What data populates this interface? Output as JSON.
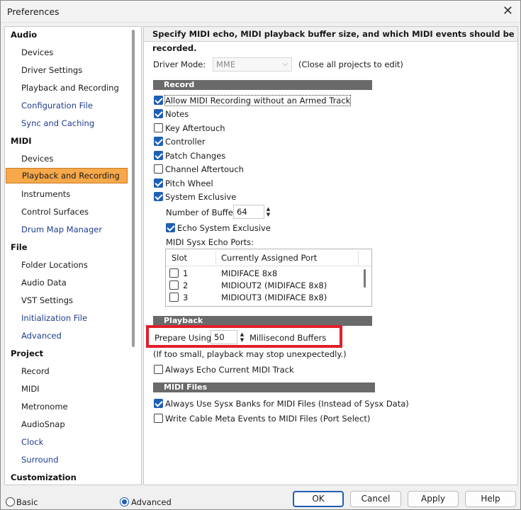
{
  "window": {
    "title": "Preferences"
  },
  "tree": {
    "sections": [
      {
        "label": "Audio",
        "items": [
          {
            "label": "Devices",
            "link": false
          },
          {
            "label": "Driver Settings",
            "link": false
          },
          {
            "label": "Playback and Recording",
            "link": false
          },
          {
            "label": "Configuration File",
            "link": true
          },
          {
            "label": "Sync and Caching",
            "link": true
          }
        ]
      },
      {
        "label": "MIDI",
        "items": [
          {
            "label": "Devices",
            "link": false
          },
          {
            "label": "Playback and Recording",
            "link": false,
            "selected": true
          },
          {
            "label": "Instruments",
            "link": false
          },
          {
            "label": "Control Surfaces",
            "link": false
          },
          {
            "label": "Drum Map Manager",
            "link": true
          }
        ]
      },
      {
        "label": "File",
        "items": [
          {
            "label": "Folder Locations",
            "link": false
          },
          {
            "label": "Audio Data",
            "link": false
          },
          {
            "label": "VST Settings",
            "link": false
          },
          {
            "label": "Initialization File",
            "link": true
          },
          {
            "label": "Advanced",
            "link": true
          }
        ]
      },
      {
        "label": "Project",
        "items": [
          {
            "label": "Record",
            "link": false
          },
          {
            "label": "MIDI",
            "link": false
          },
          {
            "label": "Metronome",
            "link": false
          },
          {
            "label": "AudioSnap",
            "link": false
          },
          {
            "label": "Clock",
            "link": true
          },
          {
            "label": "Surround",
            "link": true
          }
        ]
      },
      {
        "label": "Customization",
        "items": []
      }
    ]
  },
  "panel": {
    "description": "Specify MIDI echo, MIDI playback buffer size, and which MIDI events should be recorded.",
    "driver_mode": {
      "label": "Driver Mode:",
      "value": "MME",
      "note": "(Close all projects to edit)"
    },
    "record": {
      "header": "Record",
      "options": [
        {
          "label": "Allow MIDI Recording without an Armed Track",
          "checked": true
        },
        {
          "label": "Notes",
          "checked": true
        },
        {
          "label": "Key Aftertouch",
          "checked": false
        },
        {
          "label": "Controller",
          "checked": true
        },
        {
          "label": "Patch Changes",
          "checked": true
        },
        {
          "label": "Channel Aftertouch",
          "checked": false
        },
        {
          "label": "Pitch Wheel",
          "checked": true
        },
        {
          "label": "System Exclusive",
          "checked": true
        }
      ],
      "buffers": {
        "label": "Number of Buffers:",
        "value": "64"
      },
      "echo_sysx": {
        "label": "Echo System Exclusive",
        "checked": true
      },
      "echo_ports_label": "MIDI Sysx Echo Ports:",
      "ports_table": {
        "columns": [
          "Slot",
          "Currently Assigned Port"
        ],
        "rows": [
          {
            "slot": "1",
            "port": "MIDIFACE 8x8"
          },
          {
            "slot": "2",
            "port": "MIDIOUT2 (MIDIFACE 8x8)"
          },
          {
            "slot": "3",
            "port": "MIDIOUT3 (MIDIFACE 8x8)"
          }
        ]
      }
    },
    "playback": {
      "header": "Playback",
      "prepare_label": "Prepare Using:",
      "prepare_value": "50",
      "prepare_unit": "Millisecond Buffers",
      "warning": "(If too small, playback may stop unexpectedly.)",
      "always_echo": {
        "label": "Always Echo Current MIDI Track",
        "checked": false
      }
    },
    "midi_files": {
      "header": "MIDI Files",
      "options": [
        {
          "label": "Always Use Sysx Banks for MIDI Files (Instead of Sysx Data)",
          "checked": true
        },
        {
          "label": "Write Cable Meta Events to MIDI Files (Port Select)",
          "checked": false
        }
      ]
    }
  },
  "footer": {
    "mode_basic": "Basic",
    "mode_advanced": "Advanced",
    "selected_mode": "advanced",
    "buttons": {
      "ok": "OK",
      "cancel": "Cancel",
      "apply": "Apply",
      "help": "Help"
    }
  },
  "colors": {
    "accent": "#1f5fb5",
    "selection": "#f7a84a",
    "highlight_box": "#e0202a",
    "section_bar": "#6a6a6a"
  }
}
